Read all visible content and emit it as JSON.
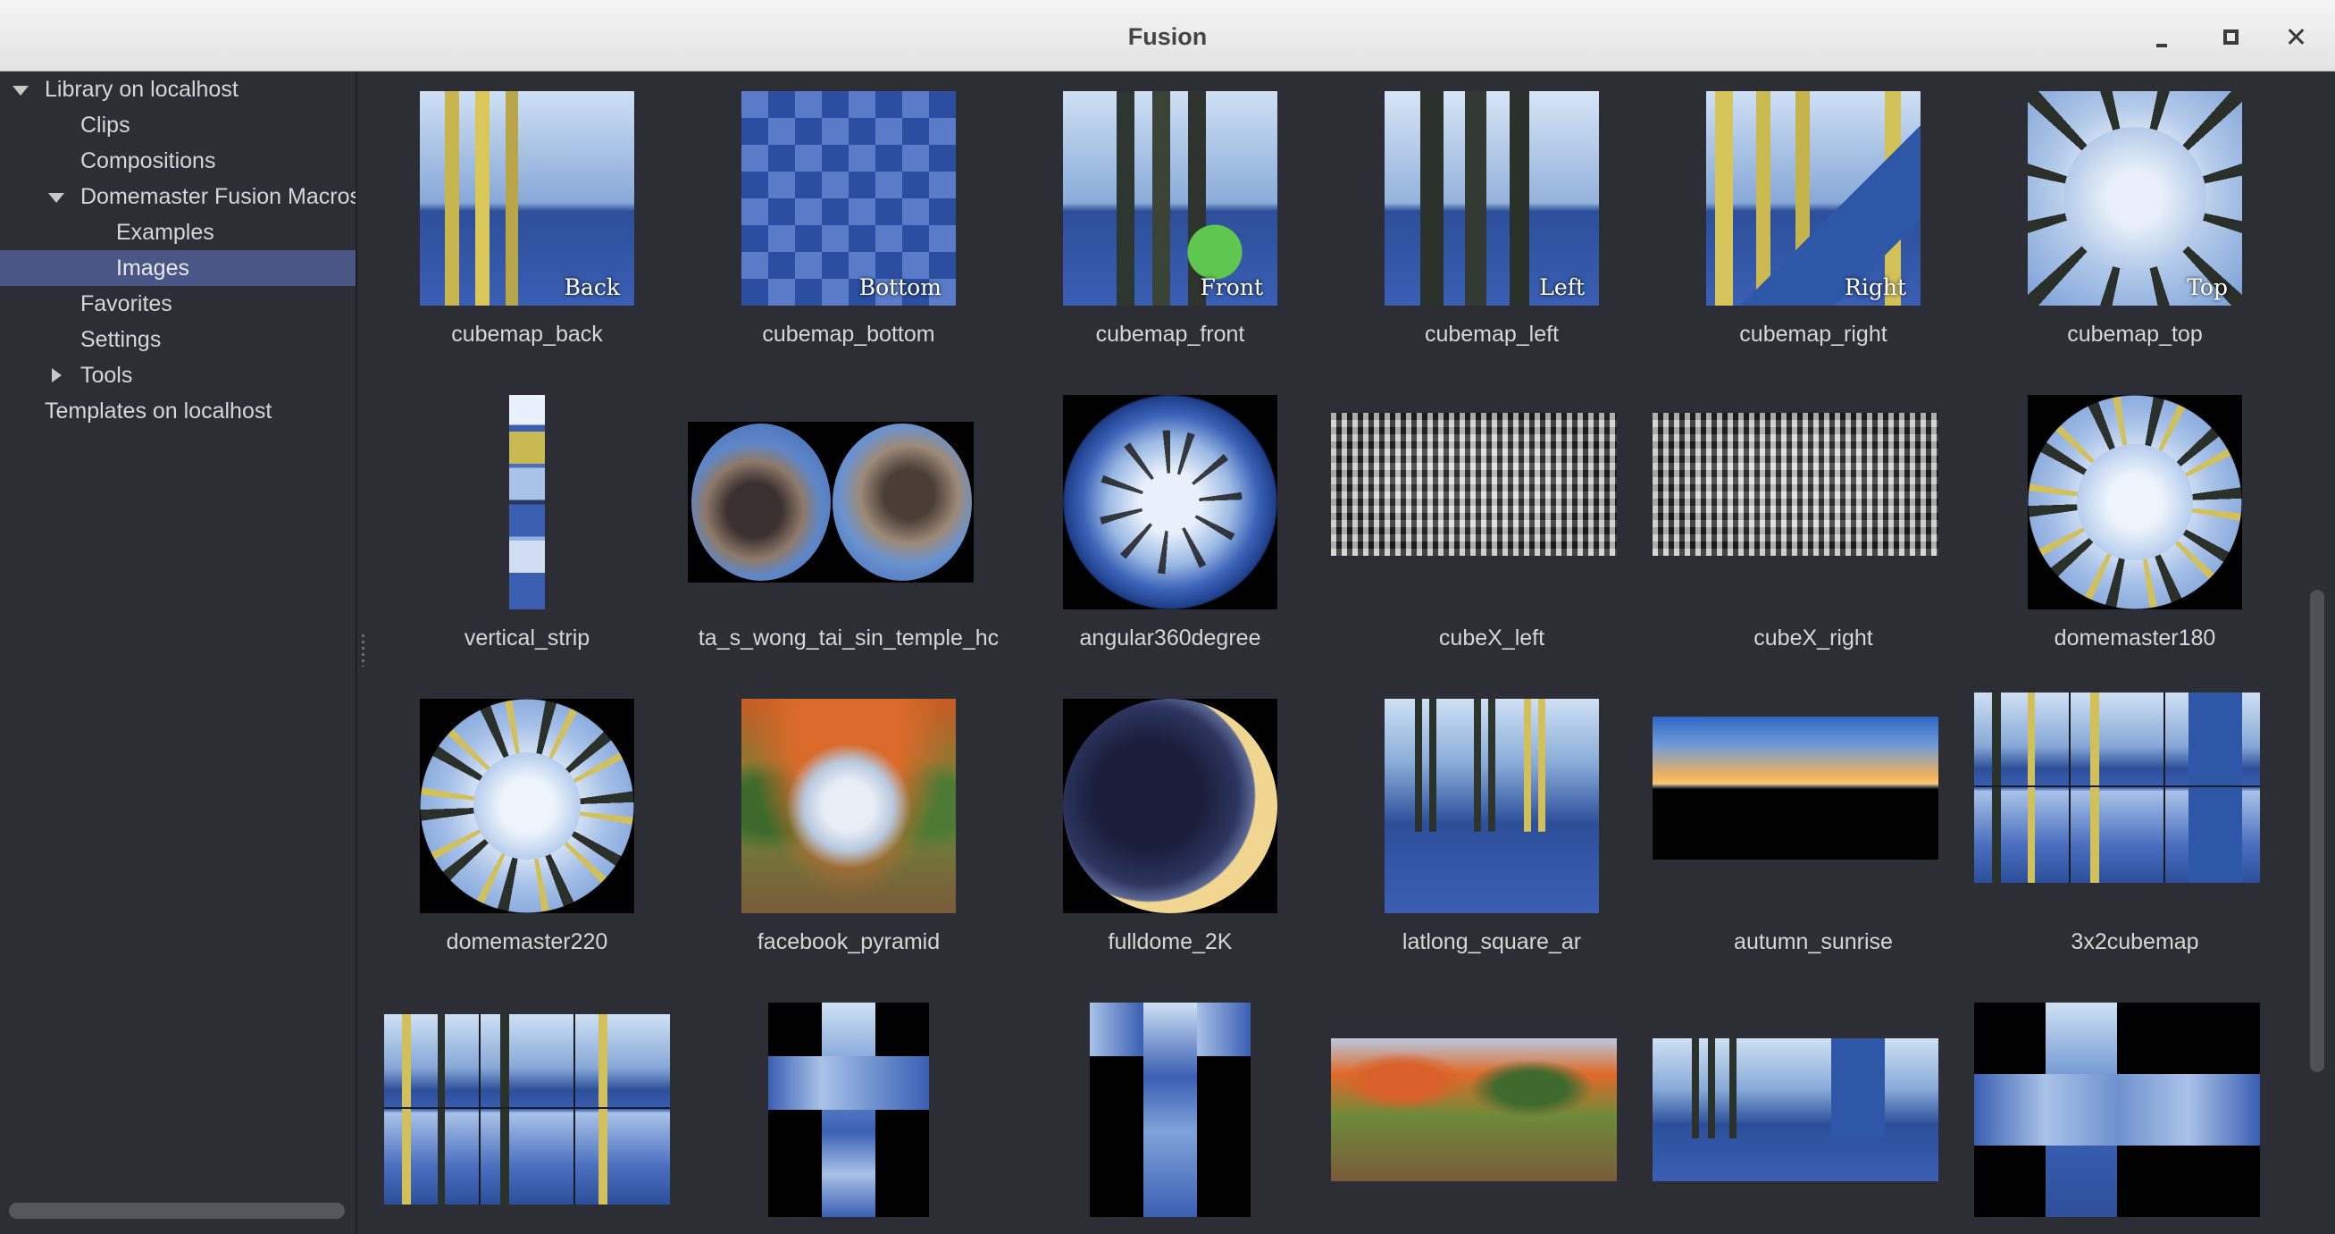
{
  "window": {
    "title": "Fusion"
  },
  "title_buttons": {
    "minimize": "minimize-icon",
    "maximize": "maximize-icon",
    "close": "close-icon"
  },
  "sidebar": {
    "items": [
      {
        "label": "Library on localhost",
        "expanded": true
      },
      {
        "label": "Clips"
      },
      {
        "label": "Compositions"
      },
      {
        "label": "Domemaster Fusion Macros",
        "expanded": true
      },
      {
        "label": "Examples"
      },
      {
        "label": "Images",
        "selected": true
      },
      {
        "label": "Favorites"
      },
      {
        "label": "Settings"
      },
      {
        "label": "Tools",
        "expanded": false
      },
      {
        "label": "Templates on localhost"
      }
    ]
  },
  "thumbnails": {
    "cubemap_back": {
      "name": "cubemap_back",
      "overlay": "Back"
    },
    "cubemap_bottom": {
      "name": "cubemap_bottom",
      "overlay": "Bottom"
    },
    "cubemap_front": {
      "name": "cubemap_front",
      "overlay": "Front"
    },
    "cubemap_left": {
      "name": "cubemap_left",
      "overlay": "Left"
    },
    "cubemap_right": {
      "name": "cubemap_right",
      "overlay": "Right"
    },
    "cubemap_top": {
      "name": "cubemap_top",
      "overlay": "Top"
    },
    "vertical_strip": {
      "name": "vertical_strip"
    },
    "temple": {
      "name": "ta_s_wong_tai_sin_temple_hc"
    },
    "angular360degree": {
      "name": "angular360degree"
    },
    "cubeX_left": {
      "name": "cubeX_left"
    },
    "cubeX_right": {
      "name": "cubeX_right"
    },
    "domemaster180": {
      "name": "domemaster180"
    },
    "domemaster220": {
      "name": "domemaster220"
    },
    "facebook_pyramid": {
      "name": "facebook_pyramid"
    },
    "fulldome_2K": {
      "name": "fulldome_2K"
    },
    "latlong_square_ar": {
      "name": "latlong_square_ar"
    },
    "autumn_sunrise": {
      "name": "autumn_sunrise"
    },
    "3x2cubemap": {
      "name": "3x2cubemap"
    }
  },
  "colors": {
    "background": "#2c2d35",
    "selection": "#4a5786",
    "text": "#d6d6d6",
    "titlebar": "#eeeeee"
  }
}
